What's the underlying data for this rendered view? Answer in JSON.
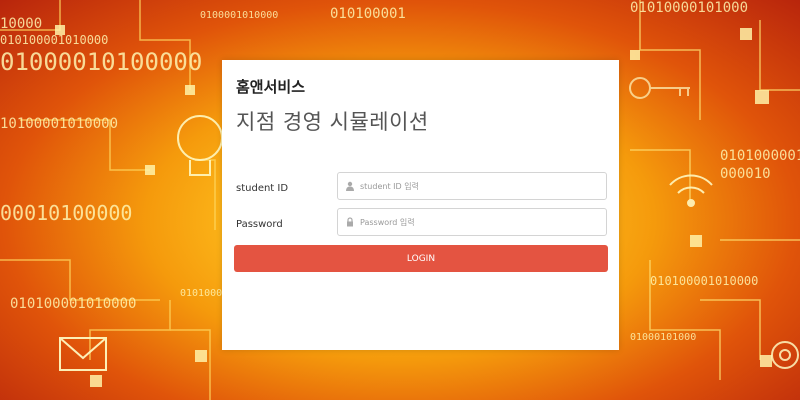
{
  "login_card": {
    "company_name": "홈앤서비스",
    "app_title": "지점 경영 시뮬레이션",
    "student_id": {
      "label": "student ID",
      "placeholder": "student ID 입력",
      "icon": "user-icon"
    },
    "password": {
      "label": "Password",
      "placeholder": "Password 입력",
      "icon": "lock-icon"
    },
    "login_button_label": "LOGIN"
  },
  "colors": {
    "login_button": "#e45441",
    "card_background": "#ffffff"
  }
}
